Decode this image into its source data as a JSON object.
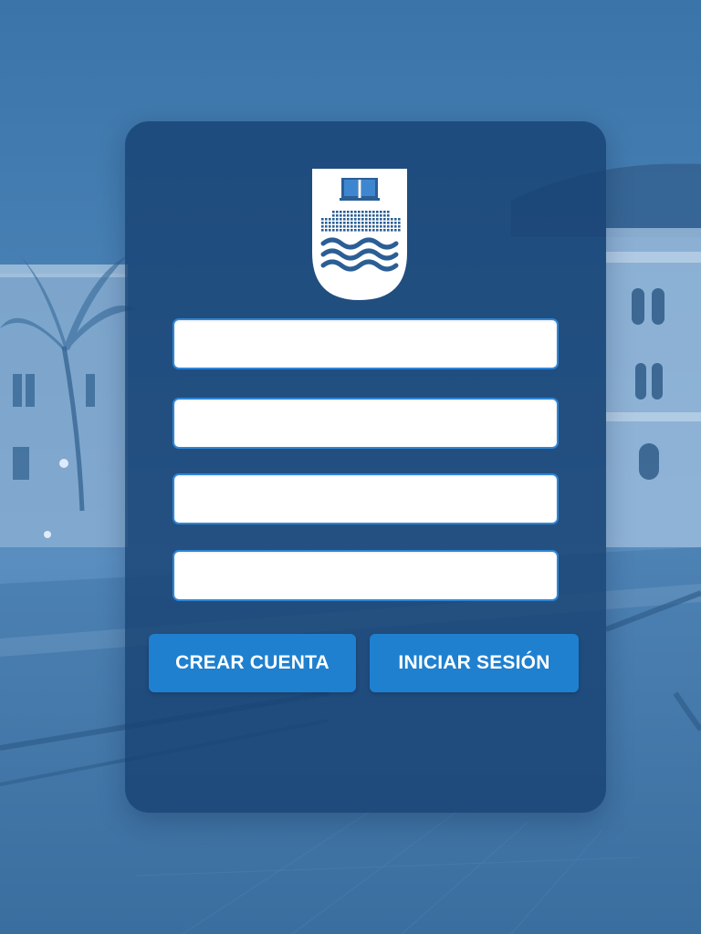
{
  "branding": {
    "crest_icon": "university-crest-icon",
    "book_icon": "open-book-icon",
    "waves_icon": "waves-icon"
  },
  "form": {
    "fields": [
      {
        "value": "",
        "placeholder": ""
      },
      {
        "value": "",
        "placeholder": ""
      },
      {
        "value": "",
        "placeholder": ""
      },
      {
        "value": "",
        "placeholder": ""
      }
    ]
  },
  "actions": {
    "create_account_label": "CREAR CUENTA",
    "login_label": "INICIAR SESIÓN"
  },
  "colors": {
    "background": "#3f78ab",
    "card": "#174172",
    "button": "#1f80cf",
    "field_border": "#2f86d6",
    "crest_fill": "#ffffff",
    "crest_mark": "#2b5e95"
  }
}
